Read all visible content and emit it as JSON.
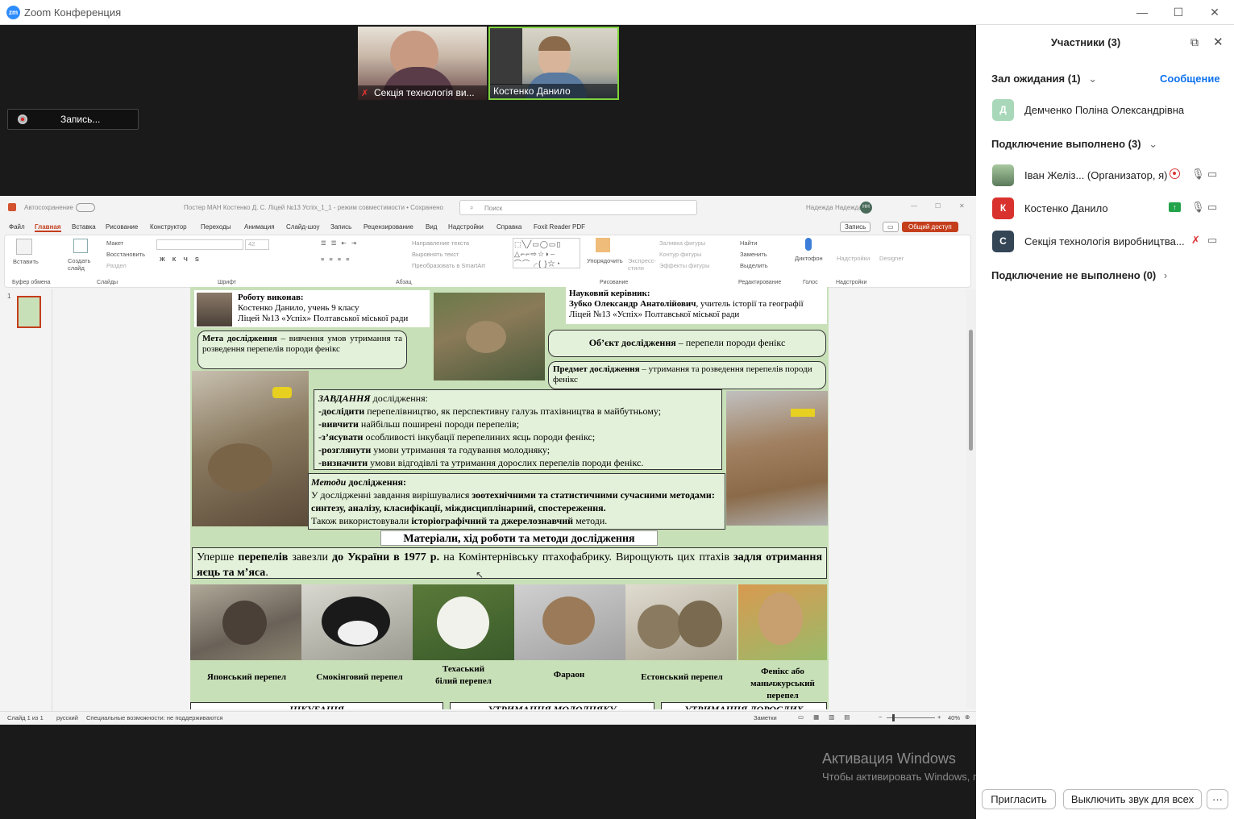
{
  "window": {
    "title": "Zoom Конференция",
    "min": "—",
    "max": "☐",
    "close": "✕"
  },
  "videos": [
    {
      "name": "Секція технологія ви...",
      "muted": true
    },
    {
      "name": "Костенко Данило",
      "muted": false
    }
  ],
  "record_button": "Запись...",
  "ppt": {
    "autosave": "Автосохранение",
    "doc_title": "Постер МАН Костенко Д. С. Ліцей №13 Успіх_1_1  -  режим совместимости • Сохранено",
    "search": "Поиск",
    "user": "Надежда Надежда",
    "user_initials": "НН",
    "tabs": [
      "Файл",
      "Главная",
      "Вставка",
      "Рисование",
      "Конструктор",
      "Переходы",
      "Анимация",
      "Слайд-шоу",
      "Запись",
      "Рецензирование",
      "Вид",
      "Надстройки",
      "Справка",
      "Foxit Reader PDF"
    ],
    "record_btn": "Запись",
    "share_btn": "Общий доступ",
    "groups": [
      "Буфер обмена",
      "Слайды",
      "Шрифт",
      "Абзац",
      "Рисование",
      "Редактирование",
      "Голос",
      "Надстройки"
    ],
    "ribbon_items": {
      "paste": "Вставить",
      "new_slide": "Создать слайд",
      "layout": "Макет",
      "reset": "Восстановить",
      "section": "Раздел",
      "font_size": "42",
      "text_dir": "Направление текста",
      "align_text": "Выровнять текст",
      "smartart": "Преобразовать в SmartArt",
      "arrange": "Упорядочить",
      "quick_styles": "Экспресс-стили",
      "fill": "Заливка фигуры",
      "outline": "Контур фигуры",
      "effects": "Эффекты фигуры",
      "find": "Найти",
      "replace": "Заменить",
      "select": "Выделить",
      "dictate": "Диктофон",
      "addins": "Надстройки",
      "designer": "Designer"
    },
    "slide_number": "1",
    "status": {
      "slide": "Слайд 1 из 1",
      "lang": "русский",
      "access": "Специальные возможности: не поддерживаются",
      "notes": "Заметки",
      "zoom": "40%"
    }
  },
  "slide": {
    "author_title": "Роботу виконав:",
    "author_l1": "Костенко Данило, учень 9 класу",
    "author_l2": "Ліцей №13 «Успіх» Полтавської міської ради",
    "sup_title": "Науковий керівник:",
    "sup_name": "Зубко Олександр Анатолійович",
    "sup_role": ", учитель історії та географії",
    "sup_l2": "Ліцей №13 «Успіх» Полтавської міської ради",
    "goal_b": "Мета дослідження",
    "goal_t": " – вивчення умов утримання та розведення перепелів породи фенікс",
    "object_b": "Об’єкт дослідження",
    "object_t": " – перепели породи фенікс",
    "subject_b": "Предмет дослідження",
    "subject_t": " – утримання та розведення перепелів породи фенікс",
    "tasks_title": "ЗАВДАННЯ",
    "tasks_title2": " дослідження:",
    "tasks": [
      {
        "b": "-дослідити",
        "t": " перепелівництво, як перспективну галузь птахівництва в майбутньому;"
      },
      {
        "b": "-вивчити",
        "t": " найбільш поширені породи перепелів;"
      },
      {
        "b": "-з’ясувати",
        "t": " особливості інкубації перепелиних яєць породи фенікс;"
      },
      {
        "b": "-розглянути",
        "t": " умови утримання та годування молодняку;"
      },
      {
        "b": "-визначити",
        "t": " умови відгодівлі та утримання дорослих перепелів породи фенікс."
      }
    ],
    "methods_title": "Методи",
    "methods_title2": " дослідження:",
    "methods_l1a": "У дослідженні завдання вирішувалися ",
    "methods_l1b": "зоотехнічними та статистичними сучасними методами: синтезу, аналізу, класифікації, міждисциплінарний, спостереження.",
    "methods_l2a": "Також використовували ",
    "methods_l2b": "історіографічний та джерелознавчий",
    "methods_l2c": " методи.",
    "materials_title": "Матеріали, хід роботи та методи дослідження",
    "intro_a": "Уперше ",
    "intro_b": "перепелів",
    "intro_c": " завезли ",
    "intro_d": "до України в 1977 р.",
    "intro_e": " на Комінтернівську птахофабрику. Вирощують цих птахів ",
    "intro_f": "задля отримання яєць та м’яса",
    "intro_g": ".",
    "breeds": [
      "Японський перепел",
      "Смокінговий перепел",
      "Техаський білий перепел",
      "Фараон",
      "Естонський перепел",
      "Фенікс або маньчжурський перепел"
    ],
    "bottom": [
      "ІНКУБАЦІЯ",
      "УТРИМАННЯ МОЛОДНЯКУ",
      "УТРИМАННЯ ДОРОСЛИХ"
    ]
  },
  "watermark": {
    "l1": "Активация Windows",
    "l2": "Чтобы активировать Windows, перейдите в раздел \"Параметры\"."
  },
  "panel": {
    "title": "Участники (3)",
    "waiting": "Зал ожидания (1)",
    "message": "Сообщение",
    "waiting_people": [
      {
        "initial": "Д",
        "name": "Демченко Поліна  Олександрівна",
        "color": "#a8d8b9"
      }
    ],
    "connected": "Подключение выполнено (3)",
    "people": [
      {
        "initial": "",
        "name": "Іван Желіз... (Организатор, я)",
        "color": "#7a9a6a"
      },
      {
        "initial": "К",
        "name": "Костенко Данило",
        "color": "#d9322e"
      },
      {
        "initial": "С",
        "name": "Секція технологія виробництва...",
        "color": "#344556"
      }
    ],
    "not_connected": "Подключение не выполнено (0)",
    "invite": "Пригласить",
    "mute_all": "Выключить звук для всех",
    "more": "···"
  }
}
